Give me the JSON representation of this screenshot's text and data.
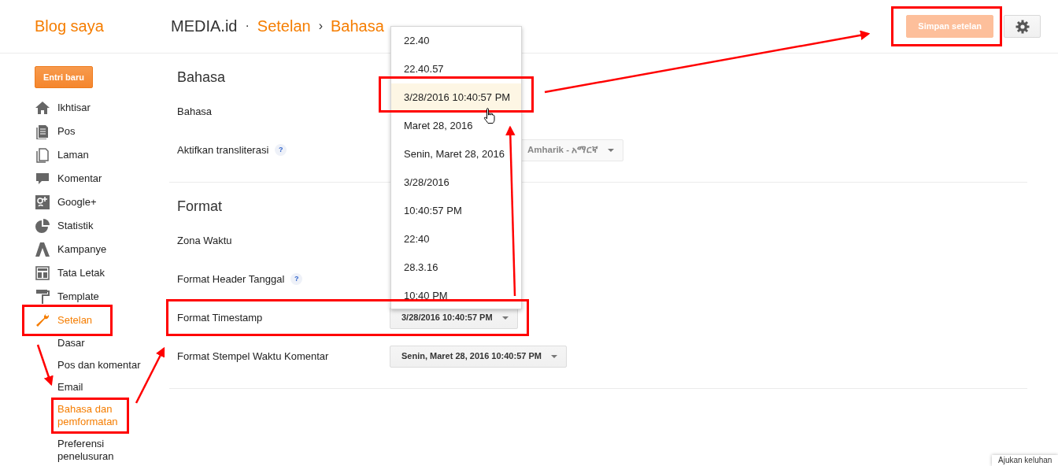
{
  "header": {
    "brand": "Blog saya",
    "breadcrumb": {
      "blog": "MEDIA.id",
      "separator": "·",
      "section": "Setelan",
      "arrow": "›",
      "page": "Bahasa"
    },
    "save_button": {
      "label": "Simpan setelan",
      "disabled": true
    }
  },
  "sidebar": {
    "new_post_button": "Entri baru",
    "items": [
      {
        "label": "Ikhtisar",
        "selected": false
      },
      {
        "label": "Pos",
        "selected": false
      },
      {
        "label": "Laman",
        "selected": false
      },
      {
        "label": "Komentar",
        "selected": false
      },
      {
        "label": "Google+",
        "selected": false
      },
      {
        "label": "Statistik",
        "selected": false
      },
      {
        "label": "Kampanye",
        "selected": false
      },
      {
        "label": "Tata Letak",
        "selected": false
      },
      {
        "label": "Template",
        "selected": false
      },
      {
        "label": "Setelan",
        "selected": true,
        "children": [
          {
            "label": "Dasar",
            "selected": false
          },
          {
            "label": "Pos dan komentar",
            "selected": false
          },
          {
            "label": "Email",
            "selected": false
          },
          {
            "label": "Bahasa dan pemformatan",
            "selected": true
          },
          {
            "label": "Preferensi penelusuran",
            "selected": false
          }
        ]
      }
    ]
  },
  "sections": [
    {
      "title": "Bahasa",
      "rows": [
        {
          "label": "Bahasa"
        },
        {
          "label": "Aktifkan transliterasi",
          "help": "?",
          "control": {
            "kind": "select",
            "value": "Amharik - አማርኛ",
            "disabled": true
          }
        }
      ]
    },
    {
      "title": "Format",
      "rows": [
        {
          "label": "Zona Waktu"
        },
        {
          "label": "Format Header Tanggal",
          "help": "?"
        },
        {
          "label": "Format Timestamp",
          "control": {
            "kind": "select",
            "value": "3/28/2016 10:40:57 PM",
            "disabled": false
          }
        },
        {
          "label": "Format Stempel Waktu Komentar",
          "control": {
            "kind": "select",
            "value": "Senin, Maret 28, 2016 10:40:57 PM",
            "disabled": false
          }
        }
      ]
    }
  ],
  "dropdown": {
    "options": [
      {
        "label": "22.40",
        "selected": false
      },
      {
        "label": "22.40.57",
        "selected": false
      },
      {
        "label": "3/28/2016 10:40:57 PM",
        "selected": true
      },
      {
        "label": "Maret 28, 2016",
        "selected": false
      },
      {
        "label": "Senin, Maret 28, 2016",
        "selected": false
      },
      {
        "label": "3/28/2016",
        "selected": false
      },
      {
        "label": "10:40:57 PM",
        "selected": false
      },
      {
        "label": "22:40",
        "selected": false
      },
      {
        "label": "28.3.16",
        "selected": false
      },
      {
        "label": "10:40 PM",
        "selected": false
      }
    ]
  },
  "feedback_tab": "Ajukan keluhan"
}
